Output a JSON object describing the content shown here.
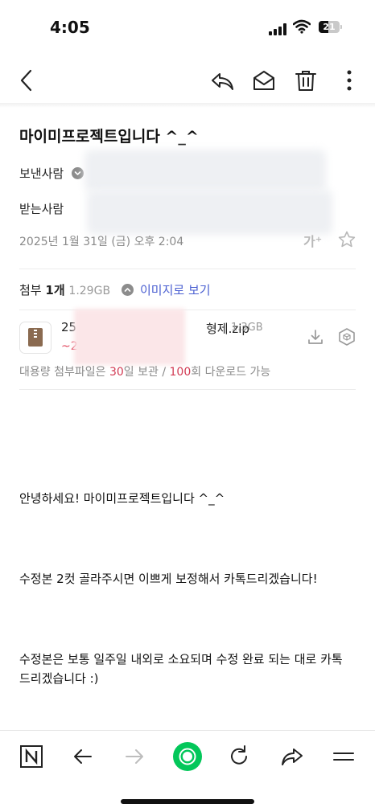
{
  "status_bar": {
    "time": "4:05",
    "battery": "21"
  },
  "toolbar": {
    "back_icon": "chevron-left-icon",
    "reply_icon": "reply-icon",
    "mark_unread_icon": "envelope-open-icon",
    "delete_icon": "trash-icon",
    "more_icon": "more-vertical-icon"
  },
  "mail": {
    "subject": "마이미프로젝트입니다 ^_^",
    "sender_label": "보낸사람",
    "recipient_label": "받는사람",
    "date": "2025년 1월 31일 (금) 오후 2:04",
    "font_size_label": "가⁺"
  },
  "attachment": {
    "label": "첨부",
    "count": "1개",
    "total_size": "1.29GB",
    "view_images": "이미지로 보기",
    "file_prefix": "25",
    "file_sub_prefix": "~2",
    "file_name_suffix": "형제.zip",
    "file_size": "1.3GB",
    "note_prefix": "대용량 첨부파일은 ",
    "note_days": "30",
    "note_middle": "일 보관 / ",
    "note_count": "100",
    "note_suffix": "회 다운로드 가능"
  },
  "body": {
    "greeting": "안녕하세요! 마이미프로젝트입니다 ^_^",
    "para1": "수정본 2컷 골라주시면 이쁘게 보정해서 카톡드리겠습니다!",
    "para2": "수정본은 보통 일주일 내외로 소요되며 수정 완료 되는 대로 카톡 드리겠습니다 :)"
  },
  "bottom_nav": {
    "brand_icon": "naver-n-icon",
    "back_icon": "arrow-left-icon",
    "forward_icon": "arrow-right-icon",
    "home_icon": "green-circle-icon",
    "reload_icon": "reload-icon",
    "share_icon": "share-icon",
    "menu_icon": "menu-icon"
  },
  "colors": {
    "accent_link": "#4a5fd1",
    "accent_red": "#d23b54",
    "brand_green": "#03c75a"
  }
}
